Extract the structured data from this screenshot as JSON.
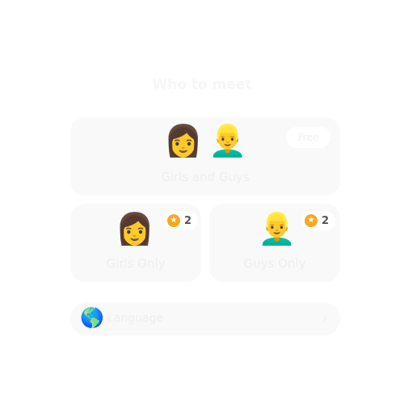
{
  "header": {
    "title": "Who to meet"
  },
  "options": {
    "both": {
      "label": "Girls and Guys",
      "badge": "Free",
      "icons": [
        "woman-red-hair-icon",
        "man-blond-icon"
      ]
    },
    "girls": {
      "label": "Girls Only",
      "cost": "2",
      "icon": "woman-red-hair-icon"
    },
    "guys": {
      "label": "Guys Only",
      "cost": "2",
      "icon": "man-blond-icon"
    }
  },
  "language": {
    "label": "Language",
    "icon": "globe-icon"
  },
  "colors": {
    "coin": "#f7a823",
    "card": "#f9f9f9"
  }
}
